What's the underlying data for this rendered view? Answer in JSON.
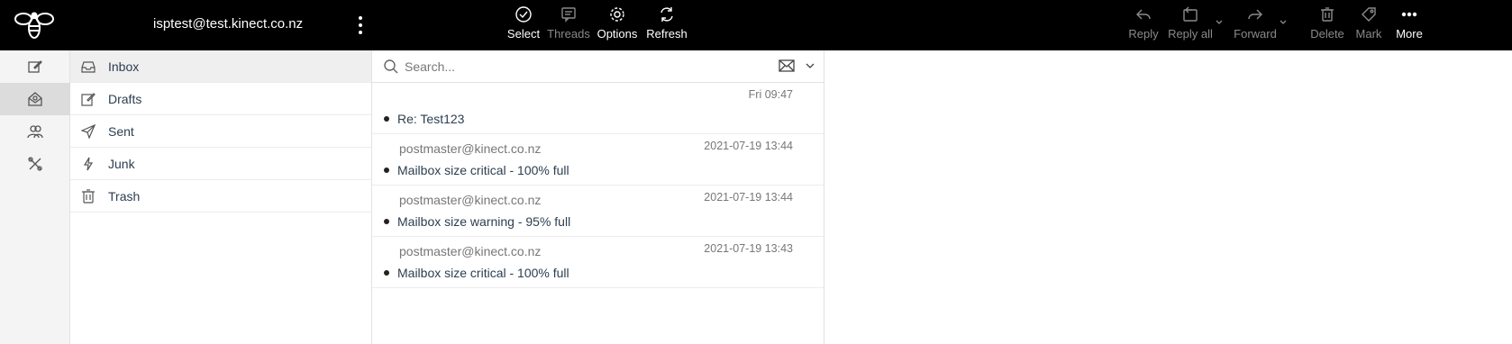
{
  "header": {
    "account": "isptest@test.kinect.co.nz",
    "toolbar": {
      "select": "Select",
      "threads": "Threads",
      "options": "Options",
      "refresh": "Refresh",
      "reply": "Reply",
      "reply_all": "Reply all",
      "forward": "Forward",
      "delete": "Delete",
      "mark": "Mark",
      "more": "More"
    }
  },
  "folders": [
    {
      "label": "Inbox",
      "icon": "inbox-icon"
    },
    {
      "label": "Drafts",
      "icon": "drafts-icon"
    },
    {
      "label": "Sent",
      "icon": "sent-icon"
    },
    {
      "label": "Junk",
      "icon": "junk-icon"
    },
    {
      "label": "Trash",
      "icon": "trash-icon"
    }
  ],
  "search": {
    "placeholder": "Search..."
  },
  "messages": [
    {
      "from": "",
      "date": "Fri 09:47",
      "subject": "Re: Test123"
    },
    {
      "from": "postmaster@kinect.co.nz",
      "date": "2021-07-19 13:44",
      "subject": "Mailbox size critical - 100% full"
    },
    {
      "from": "postmaster@kinect.co.nz",
      "date": "2021-07-19 13:44",
      "subject": "Mailbox size warning - 95% full"
    },
    {
      "from": "postmaster@kinect.co.nz",
      "date": "2021-07-19 13:43",
      "subject": "Mailbox size critical - 100% full"
    }
  ],
  "colors": {
    "header_bg": "#000000",
    "rail_bg": "#f4f4f4",
    "active_bg": "#dcdcdc",
    "muted": "#8a8a8a"
  }
}
